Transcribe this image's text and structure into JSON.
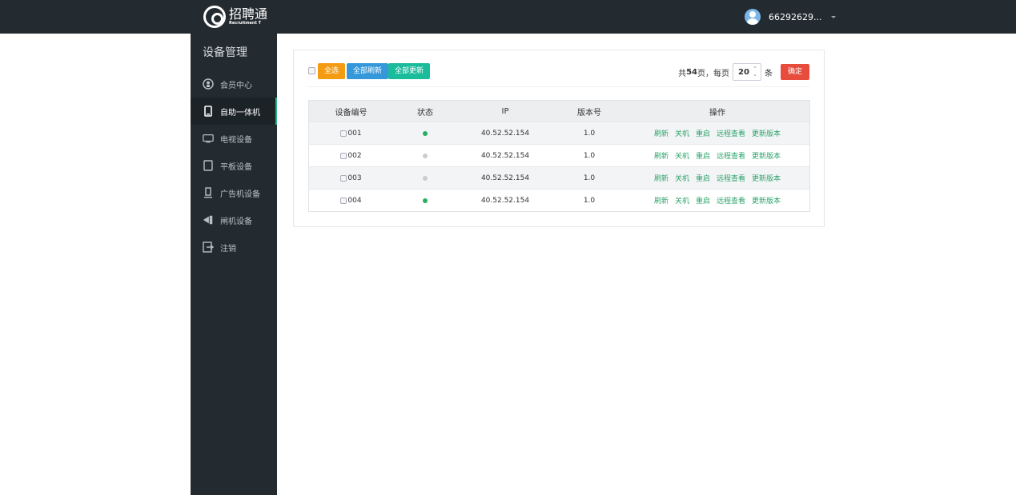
{
  "app": {
    "logo_cn": "招聘通",
    "logo_en": "Recruitment T"
  },
  "user": {
    "name": "66292629..."
  },
  "sidebar": {
    "title": "设备管理",
    "items": [
      {
        "label": "会员中心",
        "icon": "member-icon"
      },
      {
        "label": "自助一体机",
        "icon": "kiosk-icon",
        "active": true
      },
      {
        "label": "电视设备",
        "icon": "tv-icon"
      },
      {
        "label": "平板设备",
        "icon": "tablet-icon"
      },
      {
        "label": "广告机设备",
        "icon": "ad-machine-icon"
      },
      {
        "label": "闸机设备",
        "icon": "gate-icon"
      },
      {
        "label": "注销",
        "icon": "logout-icon"
      }
    ]
  },
  "toolbar": {
    "select_all": "全选",
    "refresh_all": "全部刷新",
    "update_all": "全部更新"
  },
  "pager": {
    "prefix": "共",
    "pages": "54",
    "suffix": "页，每页",
    "per_page": "20",
    "unit": "条",
    "confirm": "确定"
  },
  "table": {
    "headers": [
      "设备编号",
      "状态",
      "IP",
      "版本号",
      "操作"
    ],
    "rows": [
      {
        "id": "001",
        "status": "online",
        "ip": "40.52.52.154",
        "version": "1.0"
      },
      {
        "id": "002",
        "status": "offline",
        "ip": "40.52.52.154",
        "version": "1.0"
      },
      {
        "id": "003",
        "status": "offline",
        "ip": "40.52.52.154",
        "version": "1.0"
      },
      {
        "id": "004",
        "status": "online",
        "ip": "40.52.52.154",
        "version": "1.0"
      }
    ],
    "actions": [
      "刷新",
      "关机",
      "重启",
      "远程查看",
      "更新版本"
    ]
  },
  "colors": {
    "online": "#27ae60",
    "offline": "#cccccc",
    "action_link": "#2ea46b"
  }
}
